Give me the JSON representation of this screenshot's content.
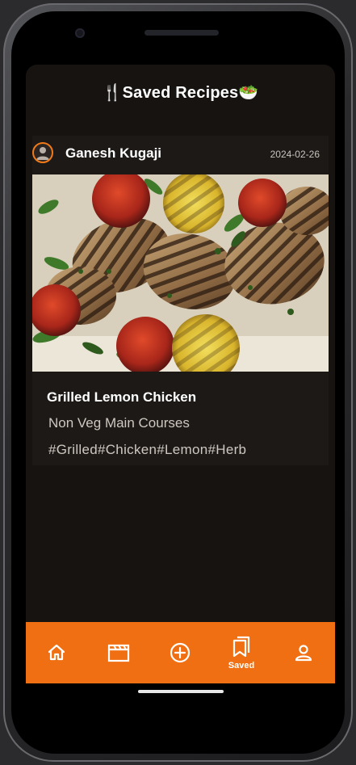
{
  "app": {
    "title": "Saved Recipes",
    "title_prefix_icon": "🍴",
    "title_suffix_icon": "🥗"
  },
  "post": {
    "author": "Ganesh Kugaji",
    "date": "2024-02-26",
    "image_alt": "Grilled lemon chicken with tomatoes and herbs",
    "title": "Grilled Lemon  Chicken",
    "category": "Non Veg Main Courses",
    "tags": "#Grilled#Chicken#Lemon#Herb"
  },
  "nav": {
    "items": [
      {
        "icon": "home-icon",
        "label": ""
      },
      {
        "icon": "clapperboard-icon",
        "label": ""
      },
      {
        "icon": "plus-circle-icon",
        "label": ""
      },
      {
        "icon": "bookmarks-icon",
        "label": "Saved",
        "active": true
      },
      {
        "icon": "user-icon",
        "label": ""
      }
    ]
  },
  "colors": {
    "accent": "#f06f12",
    "background": "#161311",
    "card": "#1c1917",
    "text": "#ffffff",
    "muted_text": "#cfc8c0"
  }
}
